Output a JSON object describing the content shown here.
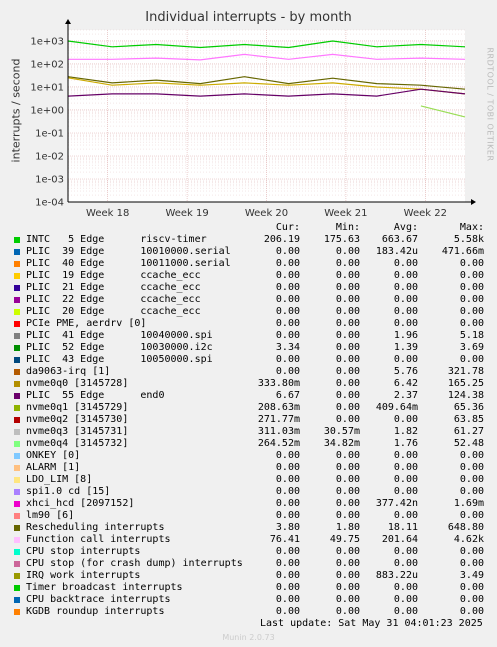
{
  "chart_data": {
    "type": "line",
    "title": "Individual interrupts - by month",
    "ylabel": "interrupts / second",
    "yscale": "log",
    "ylim": [
      0.0001,
      3000
    ],
    "ytick_labels": [
      "1e+03",
      "1e+02",
      "1e+01",
      "1e+00",
      "1e-01",
      "1e-02",
      "1e-03",
      "1e-04"
    ],
    "xtick_labels": [
      "Week 18",
      "Week 19",
      "Week 20",
      "Week 21",
      "Week 22"
    ],
    "grid": true,
    "series": [
      {
        "name": "INTC 5 Edge riscv-timer",
        "color": "#00cc00",
        "values": [
          1000,
          560,
          700,
          520,
          700,
          520,
          1000,
          560,
          700,
          560
        ]
      },
      {
        "name": "Function call interrupts",
        "color": "#ff77ff",
        "values": [
          160,
          160,
          180,
          150,
          260,
          160,
          260,
          160,
          180,
          160
        ]
      },
      {
        "name": "Rescheduling interrupts",
        "color": "#666600",
        "values": [
          28,
          15,
          20,
          14,
          28,
          14,
          24,
          14,
          12,
          8
        ]
      },
      {
        "name": "nvme0q0 [3145728]",
        "color": "#ccaa00",
        "values": [
          25,
          12,
          15,
          12,
          15,
          12,
          15,
          10,
          8,
          5
        ]
      },
      {
        "name": "PLIC 55 Edge end0",
        "color": "#660066",
        "values": [
          4,
          5,
          5,
          4,
          5,
          4,
          5,
          4,
          8,
          5
        ]
      },
      {
        "name": "nvme0q4 [3145732]",
        "color": "#99dd55",
        "values": [
          0,
          0,
          0,
          0,
          0,
          0,
          0,
          0,
          1.5,
          0.5
        ]
      }
    ]
  },
  "side_text": "RRDTOOL / TOBI OETIKER",
  "legend": {
    "headers": {
      "cur": "Cur:",
      "min": "Min:",
      "avg": "Avg:",
      "max": "Max:"
    },
    "rows": [
      {
        "label": "INTC   5 Edge      riscv-timer",
        "color": "#00cc00",
        "cur": "206.19",
        "min": "175.63",
        "avg": "663.67",
        "max": "5.58k"
      },
      {
        "label": "PLIC  39 Edge      10010000.serial",
        "color": "#0066b3",
        "cur": "0.00",
        "min": "0.00",
        "avg": "183.42u",
        "max": "471.66m"
      },
      {
        "label": "PLIC  40 Edge      10011000.serial",
        "color": "#ff8000",
        "cur": "0.00",
        "min": "0.00",
        "avg": "0.00",
        "max": "0.00"
      },
      {
        "label": "PLIC  19 Edge      ccache_ecc",
        "color": "#ffcc00",
        "cur": "0.00",
        "min": "0.00",
        "avg": "0.00",
        "max": "0.00"
      },
      {
        "label": "PLIC  21 Edge      ccache_ecc",
        "color": "#330099",
        "cur": "0.00",
        "min": "0.00",
        "avg": "0.00",
        "max": "0.00"
      },
      {
        "label": "PLIC  22 Edge      ccache_ecc",
        "color": "#990099",
        "cur": "0.00",
        "min": "0.00",
        "avg": "0.00",
        "max": "0.00"
      },
      {
        "label": "PLIC  20 Edge      ccache_ecc",
        "color": "#ccff00",
        "cur": "0.00",
        "min": "0.00",
        "avg": "0.00",
        "max": "0.00"
      },
      {
        "label": "PCIe PME, aerdrv [0]",
        "color": "#ff0000",
        "cur": "0.00",
        "min": "0.00",
        "avg": "0.00",
        "max": "0.00"
      },
      {
        "label": "PLIC  41 Edge      10040000.spi",
        "color": "#808080",
        "cur": "0.00",
        "min": "0.00",
        "avg": "1.96",
        "max": "5.18"
      },
      {
        "label": "PLIC  52 Edge      10030000.i2c",
        "color": "#008f00",
        "cur": "3.34",
        "min": "0.00",
        "avg": "1.39",
        "max": "3.69"
      },
      {
        "label": "PLIC  43 Edge      10050000.spi",
        "color": "#00487d",
        "cur": "0.00",
        "min": "0.00",
        "avg": "0.00",
        "max": "0.00"
      },
      {
        "label": "da9063-irq [1]",
        "color": "#b35a00",
        "cur": "0.00",
        "min": "0.00",
        "avg": "5.76",
        "max": "321.78"
      },
      {
        "label": "nvme0q0 [3145728]",
        "color": "#b38f00",
        "cur": "333.80m",
        "min": "0.00",
        "avg": "6.42",
        "max": "165.25"
      },
      {
        "label": "PLIC  55 Edge      end0",
        "color": "#6b006b",
        "cur": "6.67",
        "min": "0.00",
        "avg": "2.37",
        "max": "124.38"
      },
      {
        "label": "nvme0q1 [3145729]",
        "color": "#8fb300",
        "cur": "208.63m",
        "min": "0.00",
        "avg": "409.64m",
        "max": "65.36"
      },
      {
        "label": "nvme0q2 [3145730]",
        "color": "#b30000",
        "cur": "271.77m",
        "min": "0.00",
        "avg": "0.00",
        "max": "63.85"
      },
      {
        "label": "nvme0q3 [3145731]",
        "color": "#bebebe",
        "cur": "311.03m",
        "min": "30.57m",
        "avg": "1.82",
        "max": "61.27"
      },
      {
        "label": "nvme0q4 [3145732]",
        "color": "#80ff80",
        "cur": "264.52m",
        "min": "34.82m",
        "avg": "1.76",
        "max": "52.48"
      },
      {
        "label": "ONKEY [0]",
        "color": "#80c9ff",
        "cur": "0.00",
        "min": "0.00",
        "avg": "0.00",
        "max": "0.00"
      },
      {
        "label": "ALARM [1]",
        "color": "#ffc080",
        "cur": "0.00",
        "min": "0.00",
        "avg": "0.00",
        "max": "0.00"
      },
      {
        "label": "LDO_LIM [8]",
        "color": "#ffe680",
        "cur": "0.00",
        "min": "0.00",
        "avg": "0.00",
        "max": "0.00"
      },
      {
        "label": "spi1.0 cd [15]",
        "color": "#aa80ff",
        "cur": "0.00",
        "min": "0.00",
        "avg": "0.00",
        "max": "0.00"
      },
      {
        "label": "xhci_hcd [2097152]",
        "color": "#ee00cc",
        "cur": "0.00",
        "min": "0.00",
        "avg": "377.42n",
        "max": "1.69m"
      },
      {
        "label": "lm90 [6]",
        "color": "#ff8080",
        "cur": "0.00",
        "min": "0.00",
        "avg": "0.00",
        "max": "0.00"
      },
      {
        "label": "Rescheduling interrupts",
        "color": "#666600",
        "cur": "3.80",
        "min": "1.80",
        "avg": "18.11",
        "max": "648.80"
      },
      {
        "label": "Function call interrupts",
        "color": "#ffbfff",
        "cur": "76.41",
        "min": "49.75",
        "avg": "201.64",
        "max": "4.62k"
      },
      {
        "label": "CPU stop interrupts",
        "color": "#00ffcc",
        "cur": "0.00",
        "min": "0.00",
        "avg": "0.00",
        "max": "0.00"
      },
      {
        "label": "CPU stop (for crash dump) interrupts",
        "color": "#cc6699",
        "cur": "0.00",
        "min": "0.00",
        "avg": "0.00",
        "max": "0.00"
      },
      {
        "label": "IRQ work interrupts",
        "color": "#999900",
        "cur": "0.00",
        "min": "0.00",
        "avg": "883.22u",
        "max": "3.49"
      },
      {
        "label": "Timer broadcast interrupts",
        "color": "#00cc00",
        "cur": "0.00",
        "min": "0.00",
        "avg": "0.00",
        "max": "0.00"
      },
      {
        "label": "CPU backtrace interrupts",
        "color": "#0066b3",
        "cur": "0.00",
        "min": "0.00",
        "avg": "0.00",
        "max": "0.00"
      },
      {
        "label": "KGDB roundup interrupts",
        "color": "#ff8000",
        "cur": "0.00",
        "min": "0.00",
        "avg": "0.00",
        "max": "0.00"
      }
    ]
  },
  "footer": "Last update: Sat May 31 04:01:23 2025",
  "munin": "Munin 2.0.73"
}
